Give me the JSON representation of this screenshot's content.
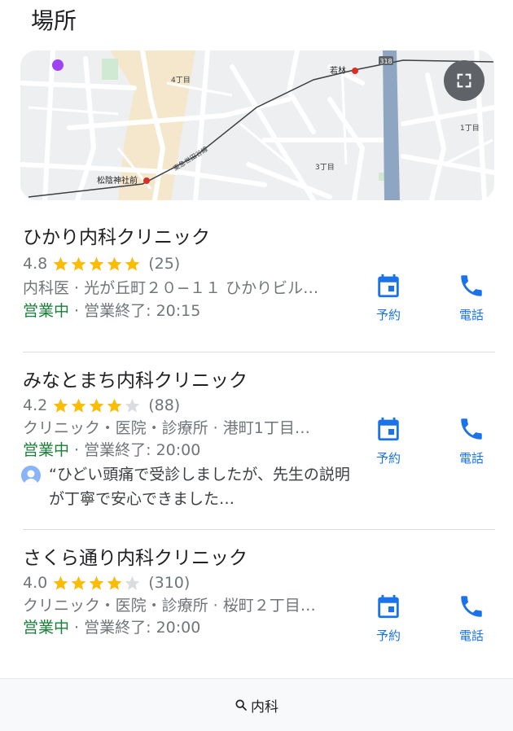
{
  "section": {
    "title": "場所"
  },
  "map": {
    "labels": {
      "district_4": "4丁目",
      "district_3": "3丁目",
      "district_1": "1丁目",
      "station_east": "若林",
      "station_west": "松陰神社前",
      "rail_line": "東急世田谷線",
      "route_shield": "318"
    }
  },
  "listings": [
    {
      "name": "ひかり内科クリニック",
      "rating": "4.8",
      "stars": 4.8,
      "reviews": "(25)",
      "info": "内科医 · 光が丘町２０−１１ ひかりビル…",
      "status": "営業中",
      "hours": " · 営業終了: 20:15",
      "book_label": "予約",
      "call_label": "電話"
    },
    {
      "name": "みなとまち内科クリニック",
      "rating": "4.2",
      "stars": 4.2,
      "reviews": "(88)",
      "info": "クリニック・医院・診療所 · 港町1丁目…",
      "status": "営業中",
      "hours": " · 営業終了: 20:00",
      "review_snippet": "“ひどい頭痛で受診しましたが、先生の説明が丁寧で安心できました…",
      "book_label": "予約",
      "call_label": "電話"
    },
    {
      "name": "さくら通り内科クリニック",
      "rating": "4.0",
      "stars": 4.0,
      "reviews": "(310)",
      "info": "クリニック・医院・診療所 · 桜町２丁目…",
      "status": "営業中",
      "hours": " · 営業終了: 20:00",
      "book_label": "予約",
      "call_label": "電話"
    }
  ],
  "search_bar": {
    "query": "内科",
    "icon": "search-icon"
  },
  "colors": {
    "open": "#188038",
    "action": "#1a73e8",
    "star": "#fbbc04",
    "star_empty": "#dadce0"
  }
}
